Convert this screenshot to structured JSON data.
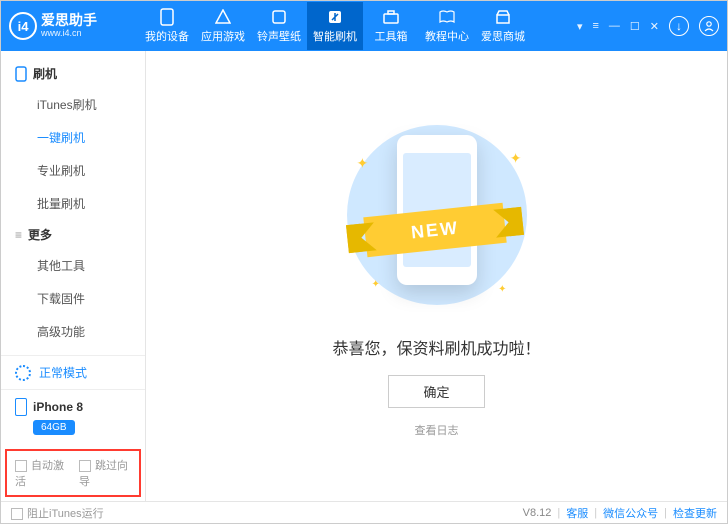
{
  "logo": {
    "title": "爱思助手",
    "icon": "i4",
    "url": "www.i4.cn"
  },
  "nav": {
    "items": [
      {
        "label": "我的设备",
        "icon": "phone"
      },
      {
        "label": "应用游戏",
        "icon": "apps"
      },
      {
        "label": "铃声壁纸",
        "icon": "music"
      },
      {
        "label": "智能刷机",
        "icon": "flash",
        "active": true
      },
      {
        "label": "工具箱",
        "icon": "toolbox"
      },
      {
        "label": "教程中心",
        "icon": "book"
      },
      {
        "label": "爱思商城",
        "icon": "shop"
      }
    ]
  },
  "sidebar": {
    "group1": {
      "title": "刷机",
      "items": [
        "iTunes刷机",
        "一键刷机",
        "专业刷机",
        "批量刷机"
      ],
      "active_index": 1
    },
    "group2": {
      "title": "更多",
      "items": [
        "其他工具",
        "下载固件",
        "高级功能"
      ]
    },
    "status": "正常模式",
    "device": {
      "name": "iPhone 8",
      "storage": "64GB"
    },
    "options": {
      "auto_activate": "自动激活",
      "skip_guide": "跳过向导"
    }
  },
  "main": {
    "ribbon": "NEW",
    "message": "恭喜您，保资料刷机成功啦！",
    "ok": "确定",
    "view_log": "查看日志"
  },
  "footer": {
    "block_itunes": "阻止iTunes运行",
    "version": "V8.12",
    "support": "客服",
    "wechat": "微信公众号",
    "check_update": "检查更新"
  }
}
